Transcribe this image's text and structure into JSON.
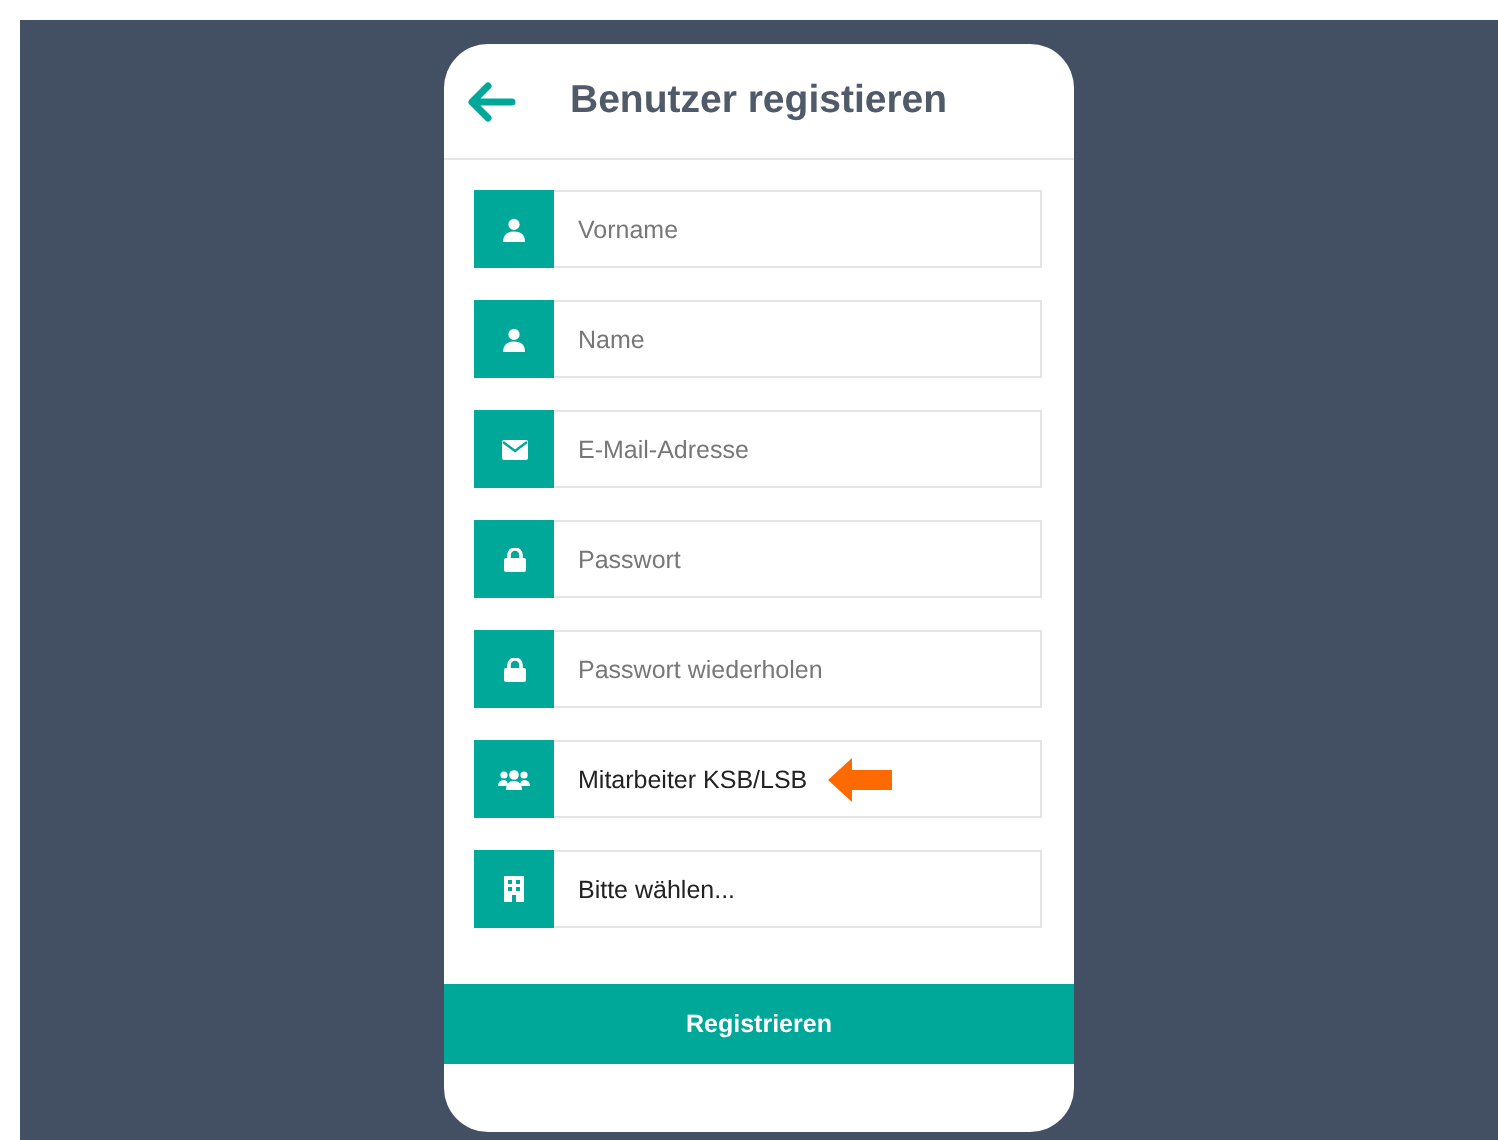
{
  "header": {
    "title": "Benutzer registieren"
  },
  "fields": [
    {
      "kind": "input",
      "placeholder": "Vorname",
      "marked": false
    },
    {
      "kind": "input",
      "placeholder": "Name",
      "marked": false
    },
    {
      "kind": "input",
      "placeholder": "E-Mail-Adresse",
      "marked": false
    },
    {
      "kind": "input",
      "placeholder": "Passwort",
      "marked": false
    },
    {
      "kind": "input",
      "placeholder": "Passwort wiederholen",
      "marked": false
    },
    {
      "kind": "select",
      "value": "Mitarbeiter KSB/LSB",
      "marked": true
    },
    {
      "kind": "select",
      "value": "Bitte wählen...",
      "marked": false
    }
  ],
  "submit_button": "Registrieren"
}
